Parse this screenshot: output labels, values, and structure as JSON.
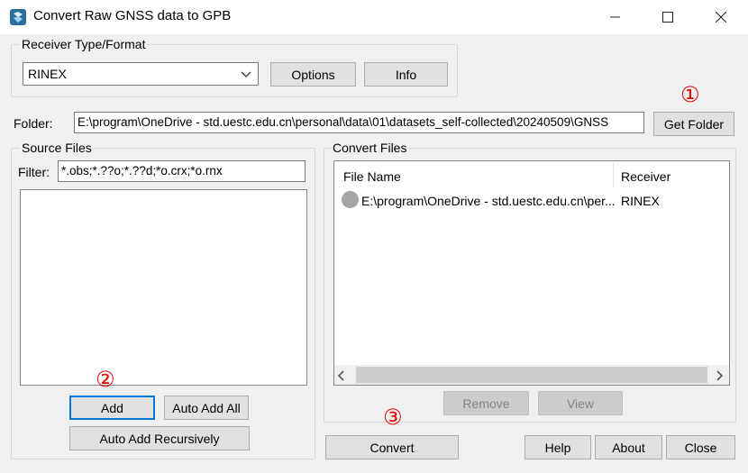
{
  "window": {
    "title": "Convert Raw GNSS data to GPB"
  },
  "receiver_group": {
    "legend": "Receiver Type/Format",
    "selected": "RINEX",
    "options_label": "Options",
    "info_label": "Info"
  },
  "folder": {
    "label": "Folder:",
    "value": "E:\\program\\OneDrive - std.uestc.edu.cn\\personal\\data\\01\\datasets_self-collected\\20240509\\GNSS",
    "get_folder_label": "Get Folder"
  },
  "source_files": {
    "legend": "Source Files",
    "filter_label": "Filter:",
    "filter_value": "*.obs;*.??o;*.??d;*o.crx;*o.rnx",
    "add_label": "Add",
    "auto_add_all_label": "Auto Add All",
    "auto_add_recursively_label": "Auto Add Recursively"
  },
  "convert_files": {
    "legend": "Convert Files",
    "columns": [
      "File Name",
      "Receiver"
    ],
    "rows": [
      {
        "file_name": "E:\\program\\OneDrive - std.uestc.edu.cn\\per...",
        "receiver": "RINEX"
      }
    ],
    "remove_label": "Remove",
    "view_label": "View"
  },
  "bottom": {
    "convert_label": "Convert",
    "help_label": "Help",
    "about_label": "About",
    "close_label": "Close"
  },
  "annotations": {
    "marker_1": "①",
    "marker_2": "②",
    "marker_3": "③"
  },
  "colors": {
    "accent": "#0078d7",
    "annotation": "#e60000",
    "window_bg": "#f0f0f0"
  }
}
